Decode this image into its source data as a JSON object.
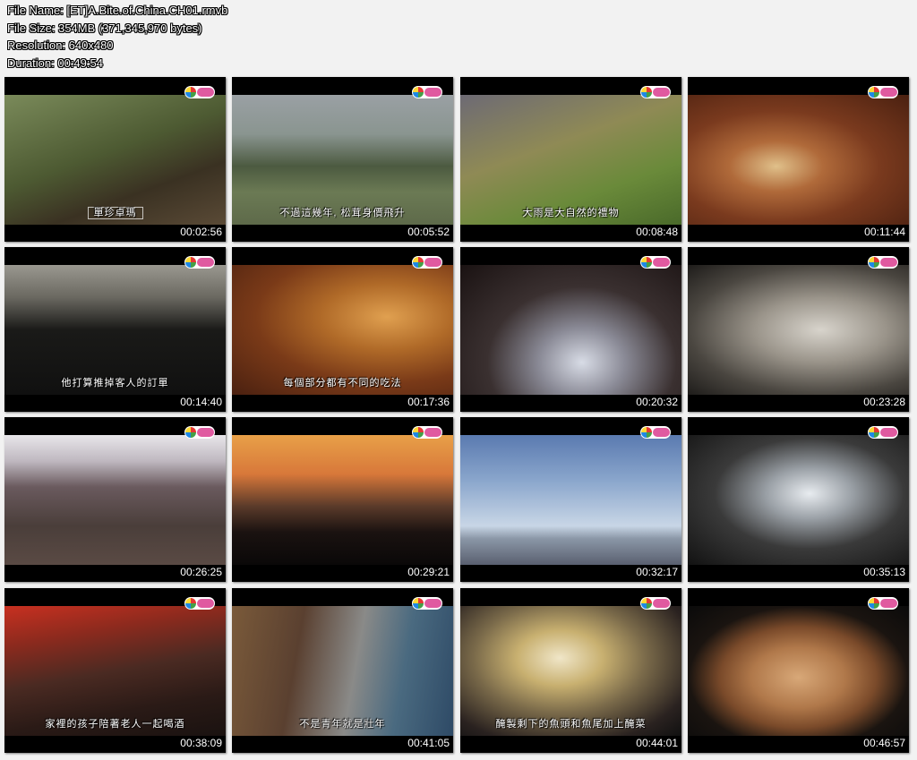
{
  "file_info": {
    "name": "File Name: [ET]A.Bite.of.China.CH01.rmvb",
    "size": "File Size: 354MB (371,345,970 bytes)",
    "resolution": "Resolution: 640x480",
    "duration": "Duration: 00:49:54"
  },
  "thumbnails": [
    {
      "time": "00:02:56",
      "subtitle": "單珍卓瑪",
      "boxed": true,
      "bg": "linear-gradient(160deg,#7a8a5a 0%,#4d5a32 45%,#3a3122 70%,#5a4a36 100%)"
    },
    {
      "time": "00:05:52",
      "subtitle": "不過這幾年, 松茸身價飛升",
      "bg": "linear-gradient(180deg,#9aa0a4 0%,#8a9590 30%,#4c5a40 55%,#6b7a54 75%,#5e6a4a 100%)"
    },
    {
      "time": "00:08:48",
      "subtitle": "大雨是大自然的禮物",
      "bg": "linear-gradient(160deg,#6d6a74 0%,#8f8a55 40%,#6a8a3a 70%,#4a6a2a 100%)"
    },
    {
      "time": "00:11:44",
      "subtitle": "",
      "bg": "radial-gradient(ellipse at 40% 55%,#e0c08a 0%,#b06a3a 25%,#7a3a1e 55%,#4a2010 100%)"
    },
    {
      "time": "00:14:40",
      "subtitle": "他打算推掉客人的訂單",
      "bg": "linear-gradient(180deg,#9a9890 0%,#6a6860 25%,#1a1a18 50%,#101010 100%)"
    },
    {
      "time": "00:17:36",
      "subtitle": "每個部分都有不同的吃法",
      "bg": "radial-gradient(ellipse at 70% 40%,#e0a050 0%,#b06a28 30%,#7a3a18 60%,#4a2010 100%)"
    },
    {
      "time": "00:20:32",
      "subtitle": "",
      "bg": "radial-gradient(ellipse at 55% 75%,#d8dce6 0%,#8a8a96 25%,#3a3030 55%,#1a1212 100%)"
    },
    {
      "time": "00:23:28",
      "subtitle": "",
      "bg": "radial-gradient(ellipse at 60% 50%,#d8d4cc 0%,#9a948a 35%,#4a4640 70%,#1e1c1a 100%)"
    },
    {
      "time": "00:26:25",
      "subtitle": "",
      "bg": "linear-gradient(180deg,#e8e6ea 0%,#bfb8c0 20%,#6a5a5e 40%,#4a3e3a 70%,#5a4a44 100%)"
    },
    {
      "time": "00:29:21",
      "subtitle": "",
      "bg": "linear-gradient(180deg,#e8a048 0%,#d8783a 30%,#5a3a2a 55%,#1a1210 75%,#0a0808 100%)"
    },
    {
      "time": "00:32:17",
      "subtitle": "",
      "bg": "linear-gradient(180deg,#5a7ab0 0%,#8aa6cc 35%,#c8d6e6 70%,#8a96a6 80%,#5a6070 100%)"
    },
    {
      "time": "00:35:13",
      "subtitle": "",
      "bg": "radial-gradient(ellipse at 55% 45%,#e8ecf0 0%,#9aa0a6 25%,#3a3a3a 55%,#121212 100%)"
    },
    {
      "time": "00:38:09",
      "subtitle": "家裡的孩子陪著老人一起喝酒",
      "bg": "linear-gradient(170deg,#c83020 0%,#8a2a1e 25%,#4a2a22 50%,#2a1a16 75%,#1a1210 100%)"
    },
    {
      "time": "00:41:05",
      "subtitle": "不是青年就是壯年",
      "bg": "linear-gradient(100deg,#7a5a3a 0%,#5a4030 30%,#8a8a88 55%,#4a6a80 75%,#2e4a66 100%)"
    },
    {
      "time": "00:44:01",
      "subtitle": "醃製剩下的魚頭和魚尾加上醃菜",
      "bg": "radial-gradient(ellipse at 45% 40%,#f0e6c8 0%,#c8b070 25%,#7a6a4a 50%,#2a2220 80%,#101010 100%)"
    },
    {
      "time": "00:46:57",
      "subtitle": "",
      "bg": "radial-gradient(ellipse at 50% 55%,#d8a878 0%,#b0784a 30%,#7a4a2a 50%,#1a1410 70%,#0a0a0a 100%)"
    }
  ]
}
